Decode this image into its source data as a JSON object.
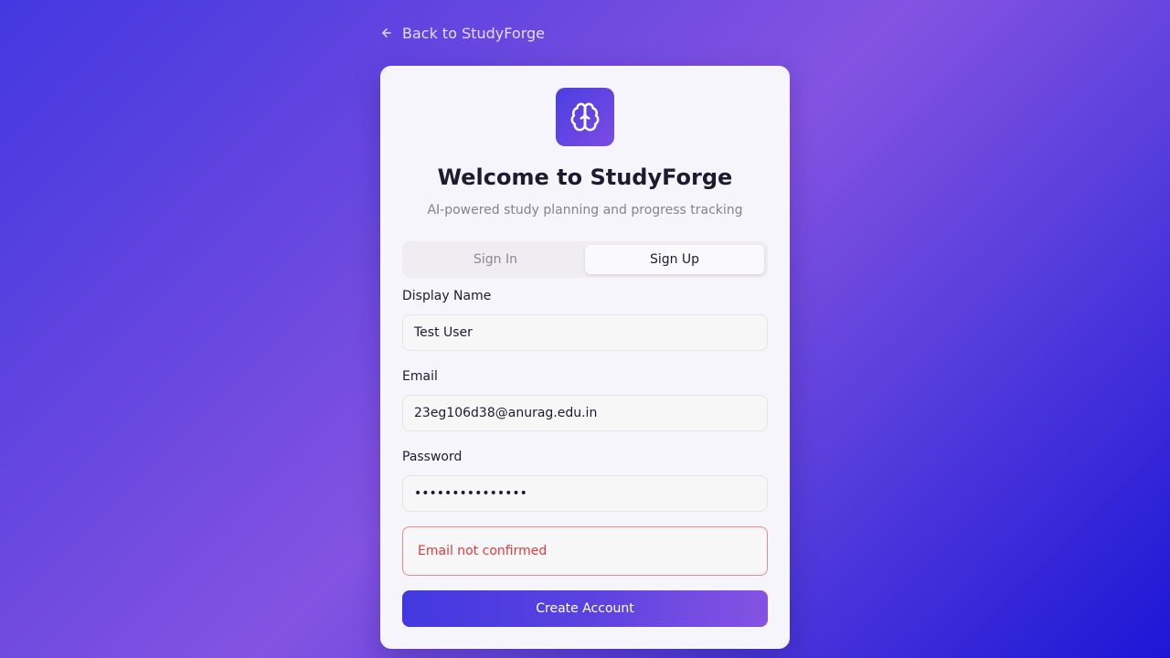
{
  "nav": {
    "back_label": "Back to StudyForge"
  },
  "header": {
    "logo_icon": "brain-icon",
    "title": "Welcome to StudyForge",
    "subtitle": "AI-powered study planning and progress tracking"
  },
  "tabs": [
    {
      "label": "Sign In",
      "active": false
    },
    {
      "label": "Sign Up",
      "active": true
    }
  ],
  "form": {
    "display_name": {
      "label": "Display Name",
      "value": "Test User"
    },
    "email": {
      "label": "Email",
      "value": "23eg106d38@anurag.edu.in"
    },
    "password": {
      "label": "Password",
      "value": "•••••••••••••••"
    },
    "error_message": "Email not confirmed",
    "submit_label": "Create Account"
  },
  "colors": {
    "accent": "#4338e0",
    "accent_end": "#8553e2",
    "error": "#e0393e"
  }
}
